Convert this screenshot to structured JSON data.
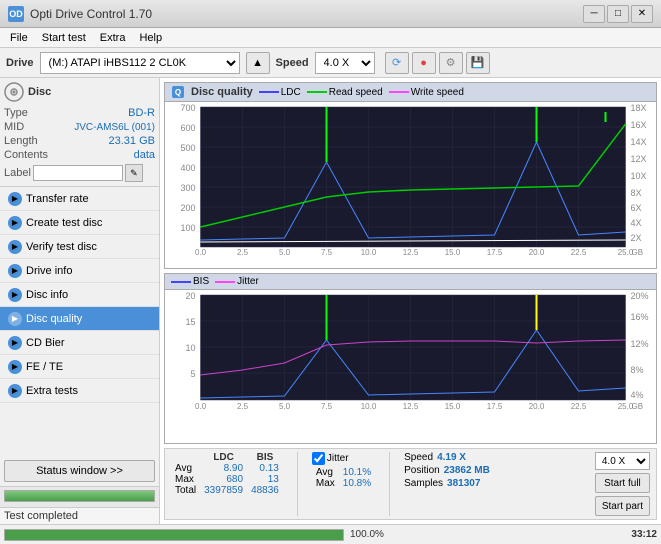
{
  "window": {
    "title": "Opti Drive Control 1.70",
    "icon": "OD"
  },
  "titlebar": {
    "controls": {
      "minimize": "─",
      "maximize": "□",
      "close": "✕"
    }
  },
  "menubar": {
    "items": [
      "File",
      "Start test",
      "Extra",
      "Help"
    ]
  },
  "toolbar": {
    "drive_label": "Drive",
    "drive_value": "(M:) ATAPI iHBS112  2 CL0K",
    "speed_label": "Speed",
    "speed_value": "4.0 X"
  },
  "disc_section": {
    "title": "Disc",
    "rows": [
      {
        "label": "Type",
        "value": "BD-R"
      },
      {
        "label": "MID",
        "value": "JVC-AMS6L (001)"
      },
      {
        "label": "Length",
        "value": "23.31 GB"
      },
      {
        "label": "Contents",
        "value": "data"
      }
    ],
    "label_row": {
      "label": "Label",
      "value": ""
    }
  },
  "nav": {
    "items": [
      {
        "id": "transfer-rate",
        "label": "Transfer rate",
        "icon_type": "blue"
      },
      {
        "id": "create-test-disc",
        "label": "Create test disc",
        "icon_type": "blue"
      },
      {
        "id": "verify-test-disc",
        "label": "Verify test disc",
        "icon_type": "blue"
      },
      {
        "id": "drive-info",
        "label": "Drive info",
        "icon_type": "blue"
      },
      {
        "id": "disc-info",
        "label": "Disc info",
        "icon_type": "blue"
      },
      {
        "id": "disc-quality",
        "label": "Disc quality",
        "icon_type": "blue",
        "active": true
      },
      {
        "id": "cd-bier",
        "label": "CD Bier",
        "icon_type": "blue"
      },
      {
        "id": "fe-te",
        "label": "FE / TE",
        "icon_type": "blue"
      },
      {
        "id": "extra-tests",
        "label": "Extra tests",
        "icon_type": "blue"
      }
    ]
  },
  "status_window_btn": "Status window >>",
  "progress": {
    "value": 100,
    "label": "100.0%"
  },
  "status_text": "Test completed",
  "chart_disc_quality": {
    "title": "Disc quality",
    "legend": [
      {
        "label": "LDC",
        "color": "#4444ff"
      },
      {
        "label": "Read speed",
        "color": "#00cc00"
      },
      {
        "label": "Write speed",
        "color": "#ff44ff"
      }
    ],
    "y_max": 700,
    "y_right_max": 18,
    "x_max": 25,
    "x_labels": [
      "0.0",
      "2.5",
      "5.0",
      "7.5",
      "10.0",
      "12.5",
      "15.0",
      "17.5",
      "20.0",
      "22.5",
      "25.0"
    ],
    "y_left_labels": [
      "700",
      "600",
      "500",
      "400",
      "300",
      "200",
      "100"
    ],
    "y_right_labels": [
      "18X",
      "16X",
      "14X",
      "12X",
      "10X",
      "8X",
      "6X",
      "4X",
      "2X"
    ]
  },
  "chart_bis_jitter": {
    "title": "",
    "legend": [
      {
        "label": "BIS",
        "color": "#4444ff"
      },
      {
        "label": "Jitter",
        "color": "#ff44ff"
      }
    ],
    "y_max": 20,
    "y_right_max": 20,
    "x_max": 25,
    "x_labels": [
      "0.0",
      "2.5",
      "5.0",
      "7.5",
      "10.0",
      "12.5",
      "15.0",
      "17.5",
      "20.0",
      "22.5",
      "25.0"
    ],
    "y_left_labels": [
      "20",
      "15",
      "10",
      "5"
    ],
    "y_right_labels": [
      "20%",
      "16%",
      "12%",
      "8%",
      "4%"
    ]
  },
  "stats": {
    "headers": [
      "LDC",
      "BIS",
      "",
      "Jitter",
      "Speed"
    ],
    "rows": [
      {
        "label": "Avg",
        "ldc": "8.90",
        "bis": "0.13",
        "jitter": "10.1%",
        "speed": "4.19 X"
      },
      {
        "label": "Max",
        "ldc": "680",
        "bis": "13",
        "jitter": "10.8%",
        "speed_label": "Position",
        "speed_val": "23862 MB"
      },
      {
        "label": "Total",
        "ldc": "3397859",
        "bis": "48836",
        "speed_label": "Samples",
        "speed_val": "381307"
      }
    ],
    "jitter_checked": true,
    "jitter_label": "Jitter",
    "speed_select": "4.0 X",
    "btns": {
      "start_full": "Start full",
      "start_part": "Start part"
    }
  },
  "bottom": {
    "status": "Test completed",
    "time": "33:12"
  }
}
